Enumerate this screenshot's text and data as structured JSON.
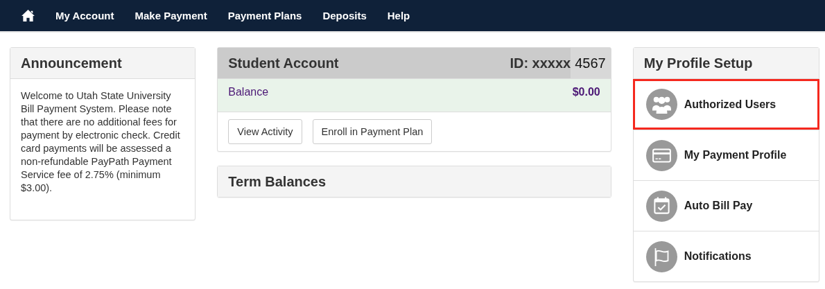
{
  "nav": {
    "items": [
      {
        "kind": "home"
      },
      {
        "label": "My Account"
      },
      {
        "label": "Make Payment"
      },
      {
        "label": "Payment Plans"
      },
      {
        "label": "Deposits"
      },
      {
        "label": "Help"
      }
    ]
  },
  "announcement": {
    "title": "Announcement",
    "text": "Welcome to Utah State University Bill Payment System. Please note that there are no additional fees for payment by electronic check. Credit card payments will be assessed a non-refundable PayPath Payment Service fee of 2.75% (minimum $3.00)."
  },
  "student_account": {
    "title": "Student Account",
    "id_label": "ID: xxxxx",
    "id_value": "4567",
    "balance_label": "Balance",
    "balance_value": "$0.00",
    "buttons": [
      "View Activity",
      "Enroll in Payment Plan"
    ]
  },
  "term_balances": {
    "title": "Term Balances"
  },
  "profile_setup": {
    "title": "My Profile Setup",
    "items": [
      {
        "kind": "users",
        "label": "Authorized Users",
        "highlighted": true
      },
      {
        "kind": "card",
        "label": "My Payment Profile",
        "highlighted": false
      },
      {
        "kind": "calendar",
        "label": "Auto Bill Pay",
        "highlighted": false
      },
      {
        "kind": "flag",
        "label": "Notifications",
        "highlighted": false
      }
    ]
  }
}
